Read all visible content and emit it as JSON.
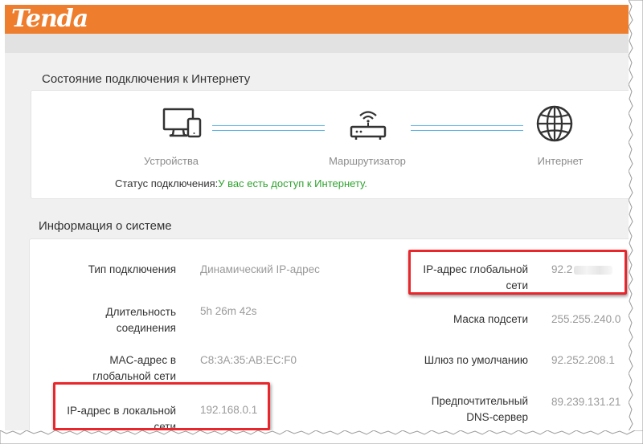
{
  "brand": {
    "logo": "Tenda",
    "accent": "#ee7d2d"
  },
  "connection": {
    "title": "Состояние подключения к Интернету",
    "nodes": {
      "devices": {
        "label": "Устройства",
        "icon": "devices-icon"
      },
      "router": {
        "label": "Маршрутизатор",
        "icon": "router-icon"
      },
      "internet": {
        "label": "Интернет",
        "icon": "globe-icon"
      }
    },
    "status_label": "Статус подключения:",
    "status_value": "У вас есть доступ к Интернету.",
    "status_color": "#2ea32e"
  },
  "system": {
    "title": "Информация о системе",
    "left": [
      {
        "label": "Тип подключения",
        "value": "Динамический IP-адрес"
      },
      {
        "label": "Длительность соединения",
        "value": "5h 26m 42s"
      },
      {
        "label": "MAC-адрес в глобальной сети",
        "value": "C8:3A:35:AB:EC:F0"
      },
      {
        "label": "IP-адрес в локальной сети",
        "value": "192.168.0.1"
      }
    ],
    "right": [
      {
        "label": "IP-адрес глобальной сети",
        "value": "92.2"
      },
      {
        "label": "Маска подсети",
        "value": "255.255.240.0"
      },
      {
        "label": "Шлюз по умолчанию",
        "value": "92.252.208.1"
      },
      {
        "label": "Предпочтительный DNS-сервер",
        "value": "89.239.131.21"
      }
    ]
  },
  "highlight_color": "#e8262b"
}
